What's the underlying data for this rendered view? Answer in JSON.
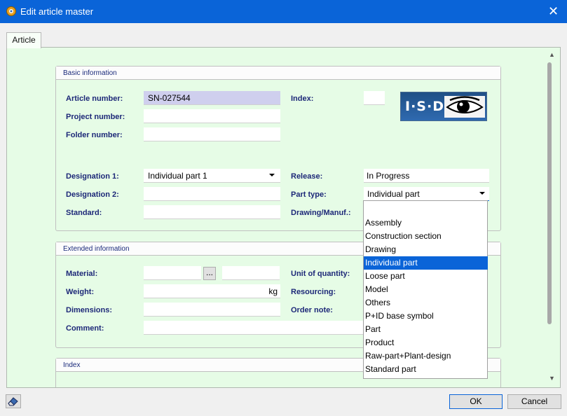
{
  "window": {
    "title": "Edit article master",
    "close_glyph": "✕"
  },
  "tabs": [
    {
      "label": "Article"
    }
  ],
  "basic": {
    "title": "Basic information",
    "article_number": {
      "label": "Article number:",
      "value": "SN-027544"
    },
    "project_number": {
      "label": "Project number:",
      "value": ""
    },
    "folder_number": {
      "label": "Folder number:",
      "value": ""
    },
    "index": {
      "label": "Index:",
      "value": ""
    },
    "logo": {
      "text": "I·S·D",
      "icon": "eye-icon"
    },
    "designation1": {
      "label": "Designation 1:",
      "value": "Individual part 1"
    },
    "designation2": {
      "label": "Designation 2:",
      "value": ""
    },
    "standard": {
      "label": "Standard:",
      "value": ""
    },
    "release": {
      "label": "Release:",
      "value": "In Progress"
    },
    "part_type": {
      "label": "Part type:",
      "value": "Individual part"
    },
    "drawing_manuf": {
      "label": "Drawing/Manuf.:",
      "value": ""
    }
  },
  "extended": {
    "title": "Extended information",
    "material": {
      "label": "Material:",
      "value": "",
      "browse_label": "..."
    },
    "weight": {
      "label": "Weight:",
      "value": "",
      "unit": "kg"
    },
    "dimensions": {
      "label": "Dimensions:",
      "value": ""
    },
    "comment": {
      "label": "Comment:",
      "value": ""
    },
    "unit_of_quantity": {
      "label": "Unit of quantity:"
    },
    "resourcing": {
      "label": "Resourcing:"
    },
    "order_note": {
      "label": "Order note:"
    }
  },
  "index_group": {
    "title": "Index"
  },
  "part_type_dropdown": {
    "selected": "Individual part",
    "options": [
      "Assembly",
      "Construction section",
      "Drawing",
      "Individual part",
      "Loose part",
      "Model",
      "Others",
      "P+ID base symbol",
      "Part",
      "Product",
      "Raw-part+Plant-design",
      "Standard part"
    ]
  },
  "footer": {
    "ok_label": "OK",
    "cancel_label": "Cancel",
    "left_icon": "eraser-icon"
  },
  "colors": {
    "titlebar": "#0a64d8",
    "panel": "#e6fce6",
    "label": "#1d2878",
    "selection": "#0a64d8",
    "article_field": "#cfcfee"
  }
}
